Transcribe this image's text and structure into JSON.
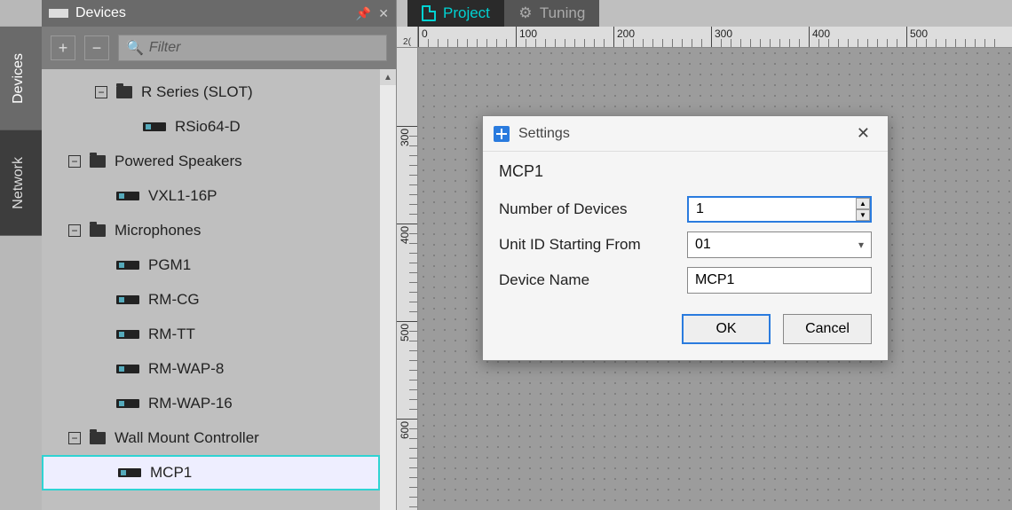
{
  "side_tabs": {
    "devices": "Devices",
    "network": "Network"
  },
  "panel": {
    "title": "Devices",
    "expand_label": "+",
    "collapse_label": "−",
    "filter_placeholder": "Filter"
  },
  "tree": [
    {
      "type": "folder",
      "label": "R Series (SLOT)",
      "indent": 2,
      "disclosure": "−"
    },
    {
      "type": "device",
      "label": "RSio64-D",
      "indent": 3
    },
    {
      "type": "folder",
      "label": "Powered Speakers",
      "indent": 1,
      "disclosure": "−"
    },
    {
      "type": "device",
      "label": "VXL1-16P",
      "indent": 2
    },
    {
      "type": "folder",
      "label": "Microphones",
      "indent": 1,
      "disclosure": "−"
    },
    {
      "type": "device",
      "label": "PGM1",
      "indent": 2
    },
    {
      "type": "device",
      "label": "RM-CG",
      "indent": 2
    },
    {
      "type": "device",
      "label": "RM-TT",
      "indent": 2
    },
    {
      "type": "device",
      "label": "RM-WAP-8",
      "indent": 2
    },
    {
      "type": "device",
      "label": "RM-WAP-16",
      "indent": 2
    },
    {
      "type": "folder",
      "label": "Wall Mount Controller",
      "indent": 1,
      "disclosure": "−"
    },
    {
      "type": "device",
      "label": "MCP1",
      "indent": 2,
      "selected": true
    }
  ],
  "tabs": {
    "project": "Project",
    "tuning": "Tuning"
  },
  "ruler": {
    "corner": "2(",
    "h_majors": [
      0,
      100,
      200,
      300,
      400,
      500
    ],
    "v_majors": [
      300,
      400,
      500,
      600
    ]
  },
  "dialog": {
    "title": "Settings",
    "heading": "MCP1",
    "fields": {
      "num_devices_label": "Number of Devices",
      "num_devices_value": "1",
      "unit_id_label": "Unit ID Starting From",
      "unit_id_value": "01",
      "device_name_label": "Device Name",
      "device_name_value": "MCP1"
    },
    "ok": "OK",
    "cancel": "Cancel"
  }
}
